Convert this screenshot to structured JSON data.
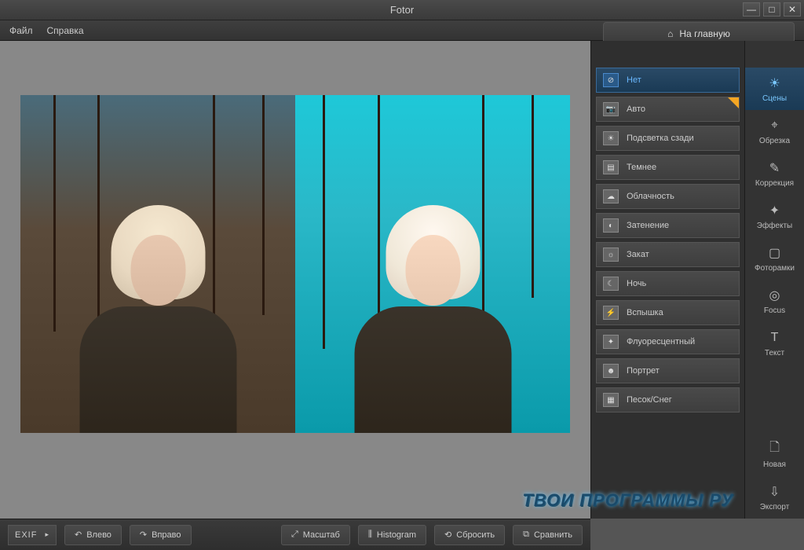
{
  "app": {
    "title": "Fotor"
  },
  "menu": {
    "file": "Файл",
    "help": "Справка"
  },
  "header": {
    "home": "На главную"
  },
  "scenes": {
    "items": [
      {
        "label": "Нет",
        "glyph": "⊘",
        "active": true,
        "auto": false
      },
      {
        "label": "Авто",
        "glyph": "📷",
        "active": false,
        "auto": true
      },
      {
        "label": "Подсветка сзади",
        "glyph": "☀",
        "active": false,
        "auto": false
      },
      {
        "label": "Темнее",
        "glyph": "▤",
        "active": false,
        "auto": false
      },
      {
        "label": "Облачность",
        "glyph": "☁",
        "active": false,
        "auto": false
      },
      {
        "label": "Затенение",
        "glyph": "◐",
        "active": false,
        "auto": false
      },
      {
        "label": "Закат",
        "glyph": "☼",
        "active": false,
        "auto": false
      },
      {
        "label": "Ночь",
        "glyph": "☾",
        "active": false,
        "auto": false
      },
      {
        "label": "Вспышка",
        "glyph": "⚡",
        "active": false,
        "auto": false
      },
      {
        "label": "Флуоресцентный",
        "glyph": "✦",
        "active": false,
        "auto": false
      },
      {
        "label": "Портрет",
        "glyph": "☻",
        "active": false,
        "auto": false
      },
      {
        "label": "Песок/Снег",
        "glyph": "▦",
        "active": false,
        "auto": false
      }
    ]
  },
  "tools": {
    "items": [
      {
        "label": "Сцены",
        "glyph": "☀",
        "active": true
      },
      {
        "label": "Обрезка",
        "glyph": "⌖",
        "active": false
      },
      {
        "label": "Коррекция",
        "glyph": "✎",
        "active": false
      },
      {
        "label": "Эффекты",
        "glyph": "✦",
        "active": false
      },
      {
        "label": "Фоторамки",
        "glyph": "▢",
        "active": false
      },
      {
        "label": "Focus",
        "glyph": "◎",
        "active": false
      },
      {
        "label": "Текст",
        "glyph": "T",
        "active": false
      }
    ],
    "bottom": [
      {
        "label": "Новая",
        "glyph": "🗋"
      },
      {
        "label": "Экспорт",
        "glyph": "⇩"
      }
    ]
  },
  "bottombar": {
    "exif": "EXIF",
    "left": "Влево",
    "right": "Вправо",
    "scale": "Масштаб",
    "histogram": "Histogram",
    "reset": "Сбросить",
    "compare": "Сравнить"
  },
  "watermark": "ТВОИ ПРОГРАММЫ РУ"
}
